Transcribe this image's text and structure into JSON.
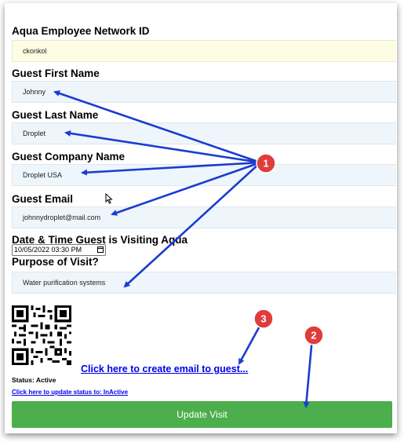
{
  "form": {
    "network_id_label": "Aqua Employee Network ID",
    "network_id_value": "ckonkol",
    "first_name_label": "Guest First Name",
    "first_name_value": "Johnny",
    "last_name_label": "Guest Last Name",
    "last_name_value": "Droplet",
    "company_label": "Guest Company Name",
    "company_value": "Droplet USA",
    "email_label": "Guest Email",
    "email_value": "johnnydroplet@mail.com",
    "datetime_label": "Date & Time Guest is Visiting Aqua",
    "datetime_value": "10/05/2022 03:30 PM",
    "purpose_label": "Purpose of Visit?",
    "purpose_value": "Water purification systems"
  },
  "qr_icon": "qr-code",
  "email_link": "Click here to create email to guest...",
  "status_text": "Status: Active",
  "status_link": "Click here to update status to: InActive",
  "update_button": "Update Visit",
  "callouts": [
    "1",
    "2",
    "3"
  ],
  "colors": {
    "button": "#4cae4c",
    "link": "#0000ee",
    "callout": "#e03c3c",
    "arrow": "#1a3ccf"
  }
}
